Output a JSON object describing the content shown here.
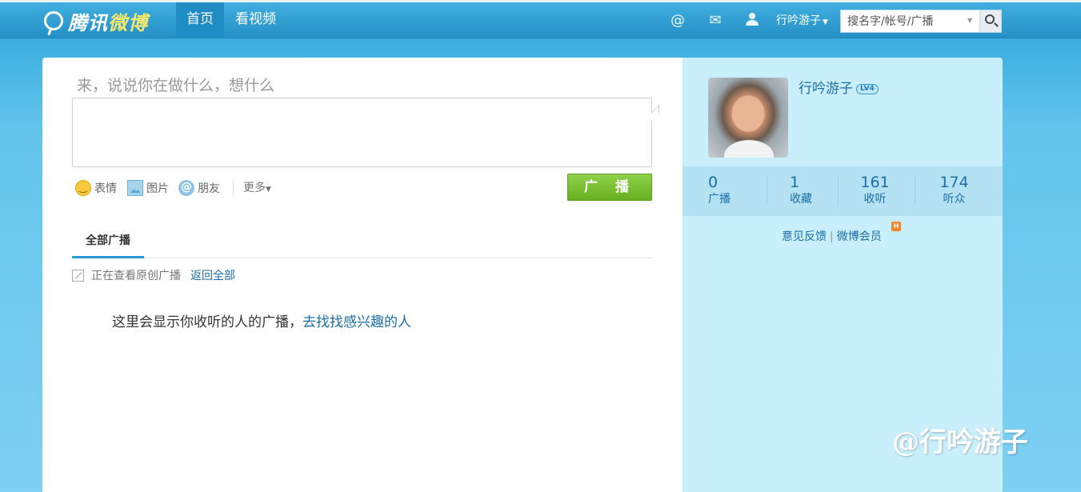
{
  "header": {
    "logo_text_a": "腾讯",
    "logo_text_b": "微博",
    "nav": [
      "首页",
      "看视频"
    ],
    "user_name": "行吟游子",
    "search_placeholder": "搜名字/帐号/广播"
  },
  "composer": {
    "prompt": "来，说说你在做什么，想什么",
    "tools": [
      "表情",
      "图片",
      "朋友"
    ],
    "more": "更多",
    "submit": "广 播"
  },
  "feed": {
    "tab": "全部广播",
    "filter_text": "正在查看原创广播",
    "filter_link": "返回全部",
    "empty_text": "这里会显示你收听的人的广播，",
    "empty_link": "去找找感兴趣的人"
  },
  "profile": {
    "name": "行吟游子",
    "level": "LV4",
    "stats": [
      {
        "num": "0",
        "label": "广播"
      },
      {
        "num": "1",
        "label": "收藏"
      },
      {
        "num": "161",
        "label": "收听"
      },
      {
        "num": "174",
        "label": "听众"
      }
    ],
    "links": [
      "意见反馈",
      "微博会员"
    ],
    "badge": "H"
  },
  "watermark": "@行吟游子",
  "colors": {
    "brand_blue": "#2aa0d3",
    "link": "#1c6ea8",
    "button_green": "#66b021"
  }
}
